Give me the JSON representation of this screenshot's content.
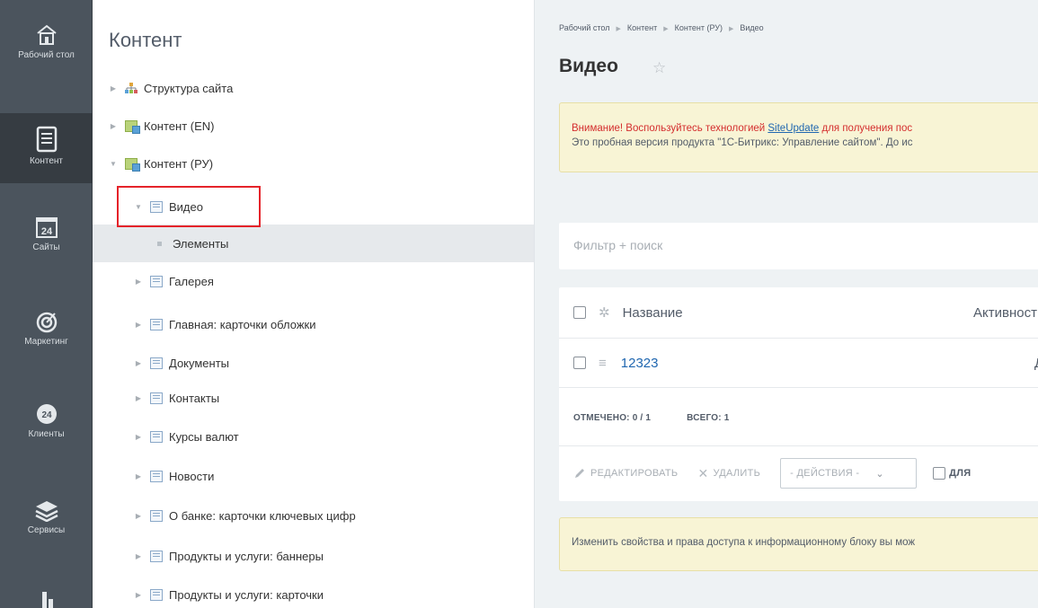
{
  "sidebar": {
    "items": [
      {
        "label": "Рабочий стол",
        "icon": "home-icon"
      },
      {
        "label": "Контент",
        "icon": "document-icon",
        "active": true
      },
      {
        "label": "Сайты",
        "icon": "calendar-24-icon"
      },
      {
        "label": "Маркетинг",
        "icon": "target-icon"
      },
      {
        "label": "Клиенты",
        "icon": "bitrix24-icon"
      },
      {
        "label": "Сервисы",
        "icon": "layers-icon"
      },
      {
        "label": "",
        "icon": "analytics-icon"
      }
    ]
  },
  "tree": {
    "title": "Контент",
    "items": [
      {
        "label": "Структура сайта",
        "icon": "site-structure-icon",
        "expanded": false
      },
      {
        "label": "Контент (EN)",
        "icon": "iblock-type-icon",
        "expanded": false
      },
      {
        "label": "Контент (РУ)",
        "icon": "iblock-type-icon",
        "expanded": true
      },
      {
        "label": "Видео",
        "icon": "iblock-icon",
        "expanded": true,
        "highlighted": true
      },
      {
        "label": "Элементы",
        "icon": "dot-icon",
        "selected": true
      },
      {
        "label": "Галерея",
        "icon": "iblock-icon"
      },
      {
        "label": "Главная: карточки обложки",
        "icon": "iblock-icon"
      },
      {
        "label": "Документы",
        "icon": "iblock-icon"
      },
      {
        "label": "Контакты",
        "icon": "iblock-icon"
      },
      {
        "label": "Курсы валют",
        "icon": "iblock-icon"
      },
      {
        "label": "Новости",
        "icon": "iblock-icon"
      },
      {
        "label": "О банке: карточки ключевых цифр",
        "icon": "iblock-icon"
      },
      {
        "label": "Продукты и услуги: баннеры",
        "icon": "iblock-icon"
      },
      {
        "label": "Продукты и услуги: карточки",
        "icon": "iblock-icon"
      }
    ]
  },
  "breadcrumb": [
    "Рабочий стол",
    "Контент",
    "Контент (РУ)",
    "Видео"
  ],
  "page": {
    "title": "Видео"
  },
  "warning": {
    "part1": "Внимание! Воспользуйтесь технологией ",
    "link": "SiteUpdate",
    "part2": " для получения пос",
    "line2": "Это пробная версия продукта \"1С-Битрикс: Управление сайтом\". До ис"
  },
  "filter": {
    "placeholder": "Фильтр + поиск"
  },
  "grid": {
    "columns": [
      "Название",
      "Активност"
    ],
    "rows": [
      {
        "name": "12323",
        "active": "Да"
      }
    ],
    "checked_label": "ОТМЕЧЕНО: 0 / 1",
    "total_label": "ВСЕГО: 1"
  },
  "actions": {
    "edit": "РЕДАКТИРОВАТЬ",
    "delete": "УДАЛИТЬ",
    "select": "- ДЕЙСТВИЯ -",
    "for_all": "ДЛЯ"
  },
  "note": "Изменить свойства и права доступа к информационному блоку вы мож",
  "colors": {
    "sidebar_bg": "#4b545d",
    "sidebar_active": "#363c42",
    "highlight_border": "#e5232a",
    "link": "#2067b0",
    "warning_bg": "#f8f4d5"
  }
}
